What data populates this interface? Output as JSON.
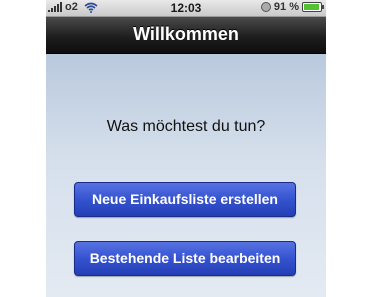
{
  "status_bar": {
    "carrier": "o2",
    "time": "12:03",
    "battery": "91 %",
    "battery_level": 0.91,
    "battery_color": "#52c234"
  },
  "nav_bar": {
    "title": "Willkommen"
  },
  "main": {
    "prompt": "Was möchtest du tun?",
    "buttons": {
      "new_list": "Neue Einkaufsliste erstellen",
      "edit_list": "Bestehende Liste bearbeiten"
    },
    "button_color": "#3553d0"
  }
}
